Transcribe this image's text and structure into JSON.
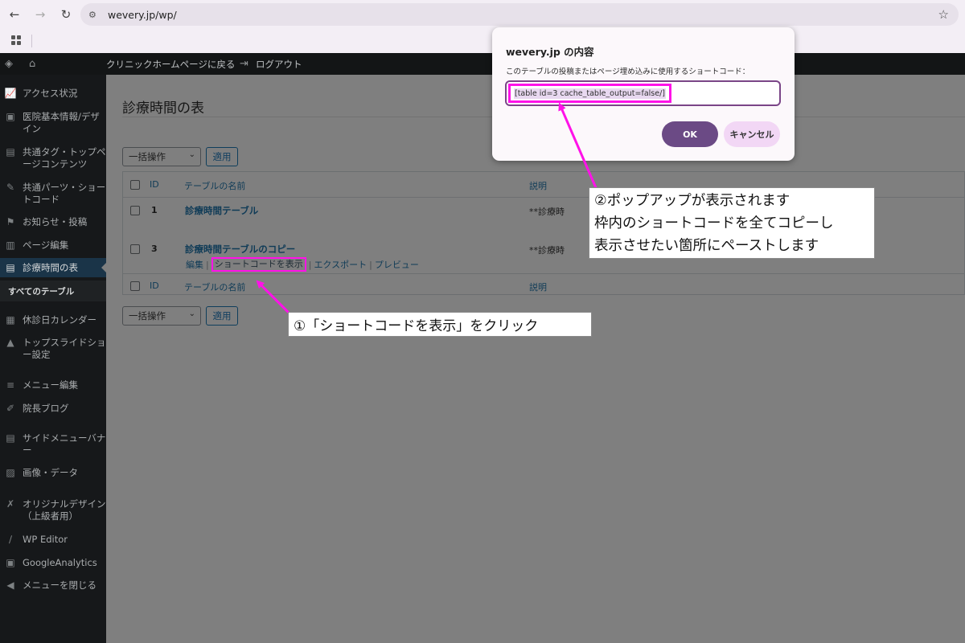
{
  "browser": {
    "url": "wevery.jp/wp/"
  },
  "adminbar": {
    "clinic_home": "クリニックホームページに戻る",
    "logout": "ログアウト"
  },
  "sidebar": {
    "items": [
      {
        "label": "アクセス状況",
        "icon": "chart-icon"
      },
      {
        "label": "医院基本情報/デザイン",
        "icon": "monitor-icon"
      },
      {
        "label": "共通タグ・トップページコンテンツ",
        "icon": "layout-icon"
      },
      {
        "label": "共通パーツ・ショートコード",
        "icon": "pin-icon"
      },
      {
        "label": "お知らせ・投稿",
        "icon": "flag-icon"
      },
      {
        "label": "ページ編集",
        "icon": "page-icon"
      },
      {
        "label": "診療時間の表",
        "icon": "table-icon"
      },
      {
        "label": "休診日カレンダー",
        "icon": "calendar-icon"
      },
      {
        "label": "トップスライドショー設定",
        "icon": "slides-icon"
      },
      {
        "label": "メニュー編集",
        "icon": "menu-icon"
      },
      {
        "label": "院長ブログ",
        "icon": "edit-icon"
      },
      {
        "label": "サイドメニューバナー",
        "icon": "banner-icon"
      },
      {
        "label": "画像・データ",
        "icon": "media-icon"
      },
      {
        "label": "オリジナルデザイン（上級者用）",
        "icon": "tools-icon"
      },
      {
        "label": "WP Editor",
        "icon": "pen-icon"
      },
      {
        "label": "GoogleAnalytics",
        "icon": "analytics-icon"
      },
      {
        "label": "メニューを閉じる",
        "icon": "collapse-icon"
      }
    ],
    "submenu_all_tables": "すべてのテーブル"
  },
  "main": {
    "page_title": "診療時間の表",
    "bulk_action": "一括操作",
    "apply": "適用",
    "columns": {
      "id": "ID",
      "name": "テーブルの名前",
      "desc": "説明"
    },
    "rows": [
      {
        "id": "1",
        "name": "診療時間テーブル",
        "desc": "**診療時間備考"
      },
      {
        "id": "3",
        "name": "診療時間テーブルのコピー",
        "desc": "**診療時間備考"
      }
    ],
    "row_actions": {
      "edit": "編集",
      "show_shortcode": "ショートコードを表示",
      "export": "エクスポート",
      "preview": "プレビュー"
    }
  },
  "dialog": {
    "title": "wevery.jp の内容",
    "message": "このテーブルの投稿またはページ埋め込みに使用するショートコード：",
    "shortcode": "[table id=3 cache_table_output=false/]",
    "ok": "OK",
    "cancel": "キャンセル"
  },
  "annotations": {
    "step1": "①「ショートコードを表示」をクリック",
    "step2_lines": [
      "②ポップアップが表示されます",
      "枠内のショートコードを全てコピーし",
      "表示させたい箇所にペーストします"
    ],
    "highlight_color": "#ff12e8"
  }
}
